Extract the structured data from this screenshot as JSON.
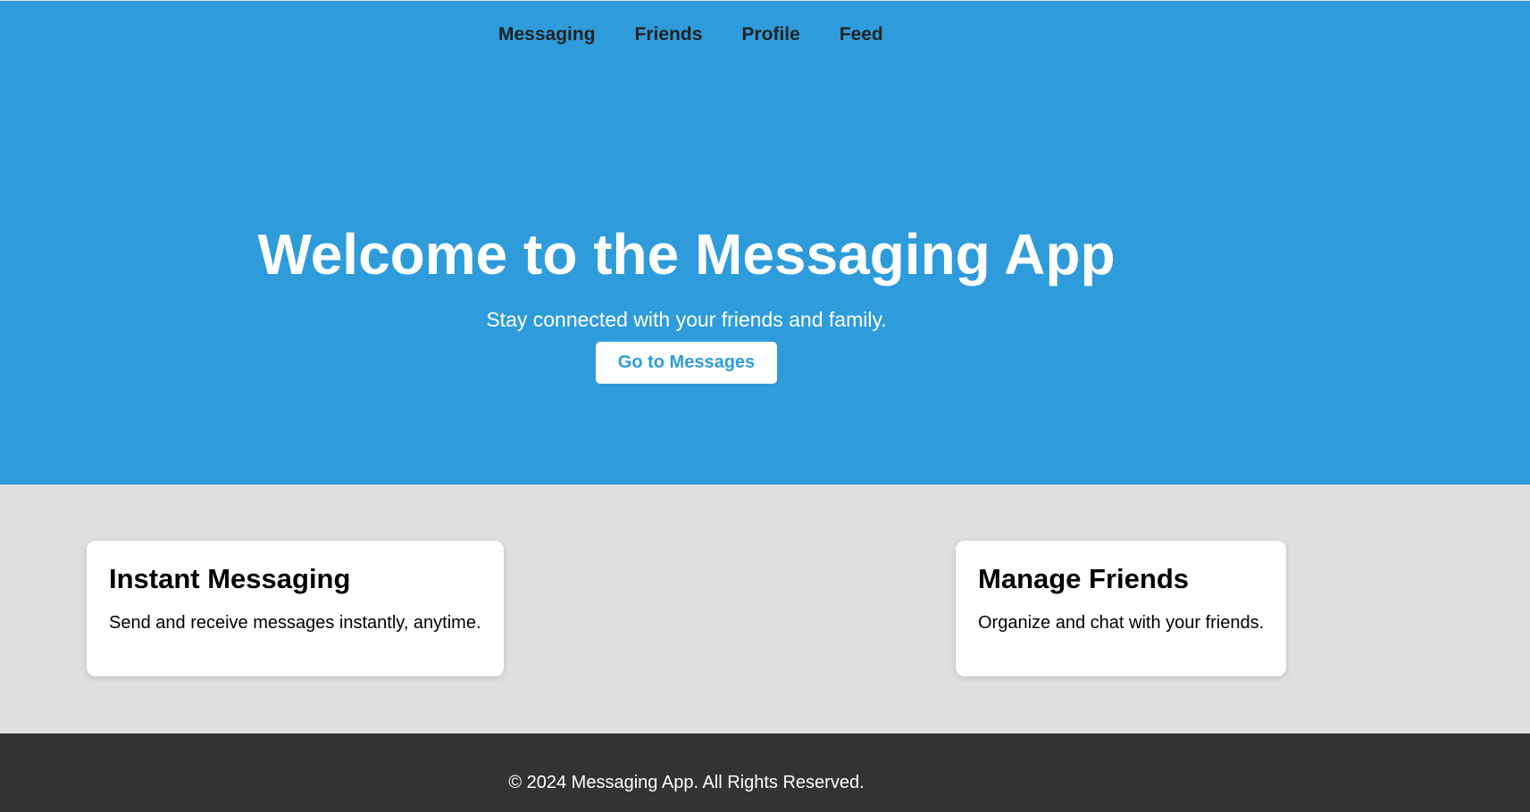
{
  "nav": {
    "items": [
      {
        "label": "Messaging"
      },
      {
        "label": "Friends"
      },
      {
        "label": "Profile"
      },
      {
        "label": "Feed"
      }
    ]
  },
  "hero": {
    "title": "Welcome to the Messaging App",
    "subtitle": "Stay connected with your friends and family.",
    "cta_label": "Go to Messages"
  },
  "features": [
    {
      "title": "Instant Messaging",
      "text": "Send and receive messages instantly, anytime."
    },
    {
      "title": "Manage Friends",
      "text": "Organize and chat with your friends."
    }
  ],
  "footer": {
    "text": "© 2024 Messaging App. All Rights Reserved."
  },
  "colors": {
    "primary": "#2e9cdb",
    "background": "#e0e0e0",
    "footer": "#333333",
    "card": "#ffffff"
  }
}
